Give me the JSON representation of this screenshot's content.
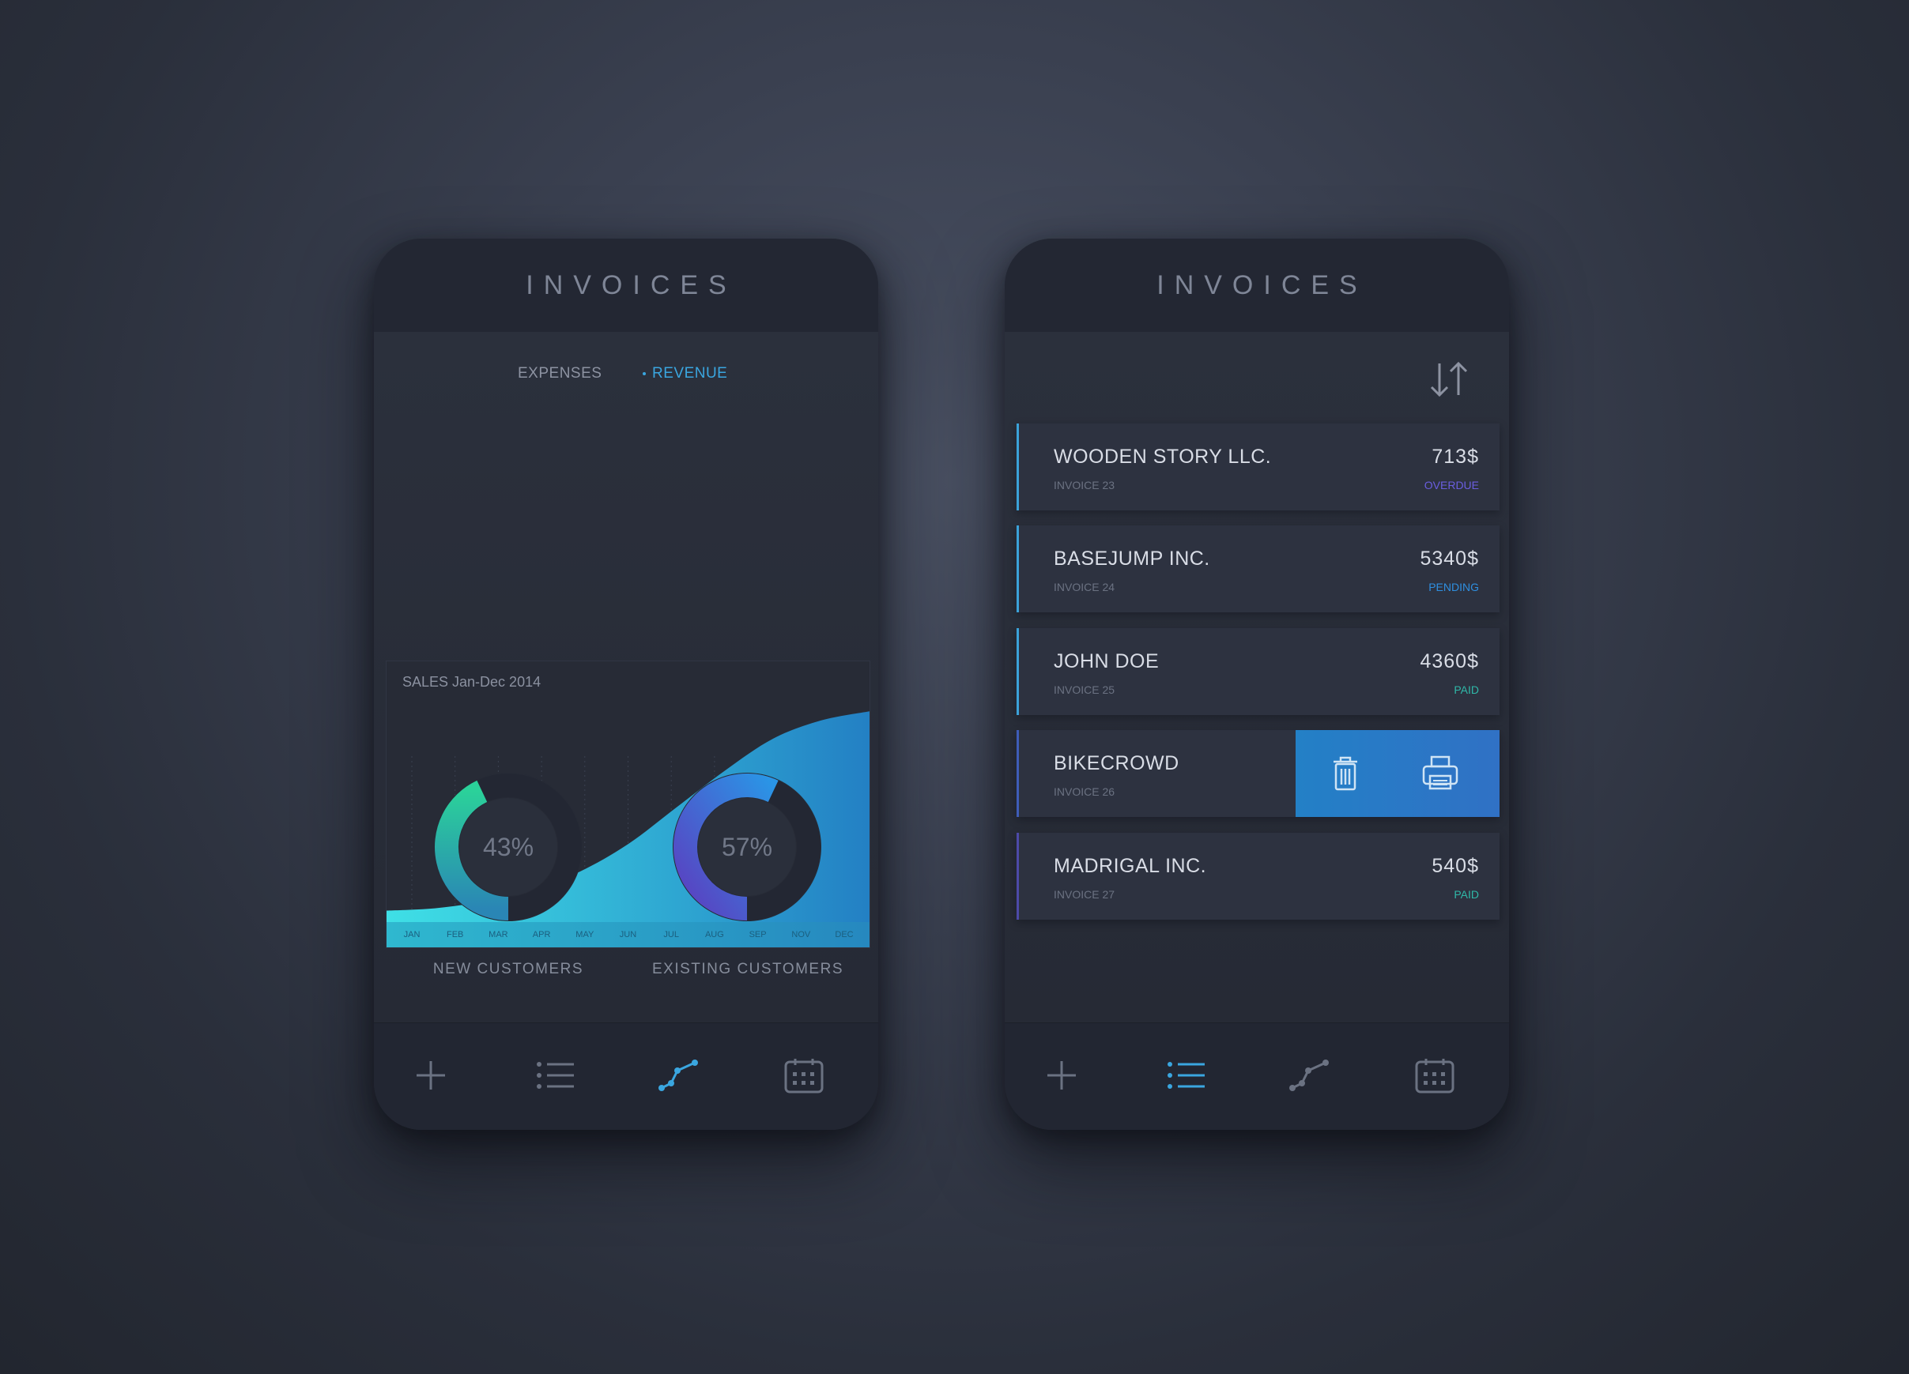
{
  "left_phone": {
    "header_title": "INVOICES",
    "toggle": {
      "expenses_label": "EXPENSES",
      "revenue_label": "REVENUE",
      "active": "revenue"
    },
    "chart_title": "SALES Jan-Dec 2014",
    "donuts": [
      {
        "percent_label": "43%",
        "value": 43,
        "label": "NEW CUSTOMERS",
        "color_start": "#2bd19a",
        "color_end": "#2a86b5"
      },
      {
        "percent_label": "57%",
        "value": 57,
        "label": "EXISTING CUSTOMERS",
        "color_start": "#2a95e6",
        "color_end": "#5b3fc0"
      }
    ],
    "tabbar": {
      "active": "chart"
    }
  },
  "chart_data": {
    "type": "area",
    "title": "SALES Jan-Dec 2014",
    "categories": [
      "JAN",
      "FEB",
      "MAR",
      "APR",
      "MAY",
      "JUN",
      "JUL",
      "AUG",
      "SEP",
      "NOV",
      "DEC"
    ],
    "values": [
      5,
      6,
      9,
      14,
      22,
      34,
      50,
      66,
      80,
      88,
      92
    ],
    "ylim": [
      0,
      100
    ],
    "grid": false,
    "fill_start": "#3fe0e6",
    "fill_end": "#2380c4"
  },
  "right_phone": {
    "header_title": "INVOICES",
    "invoices": [
      {
        "name": "WOODEN STORY LLC.",
        "number": "INVOICE 23",
        "amount": "713$",
        "status": "OVERDUE",
        "status_color": "#6a5ee0",
        "bar_color": "#3ba2d9"
      },
      {
        "name": "BASEJUMP INC.",
        "number": "INVOICE 24",
        "amount": "5340$",
        "status": "PENDING",
        "status_color": "#2e8fe0",
        "bar_color": "#3ba2d9"
      },
      {
        "name": "JOHN DOE",
        "number": "INVOICE 25",
        "amount": "4360$",
        "status": "PAID",
        "status_color": "#2fb8a8",
        "bar_color": "#3ba2d9"
      },
      {
        "name": "BIKECROWD",
        "number": "INVOICE 26",
        "amount": "",
        "status": "",
        "status_color": "#2fb8a8",
        "bar_color": "#3e5cb8"
      },
      {
        "name": "MADRIGAL INC.",
        "number": "INVOICE 27",
        "amount": "540$",
        "status": "PAID",
        "status_color": "#2fb8a8",
        "bar_color": "#4c4aa8"
      }
    ],
    "tabbar": {
      "active": "list"
    }
  },
  "colors": {
    "accent": "#3aa6e0",
    "icon_inactive": "#6b7282"
  }
}
